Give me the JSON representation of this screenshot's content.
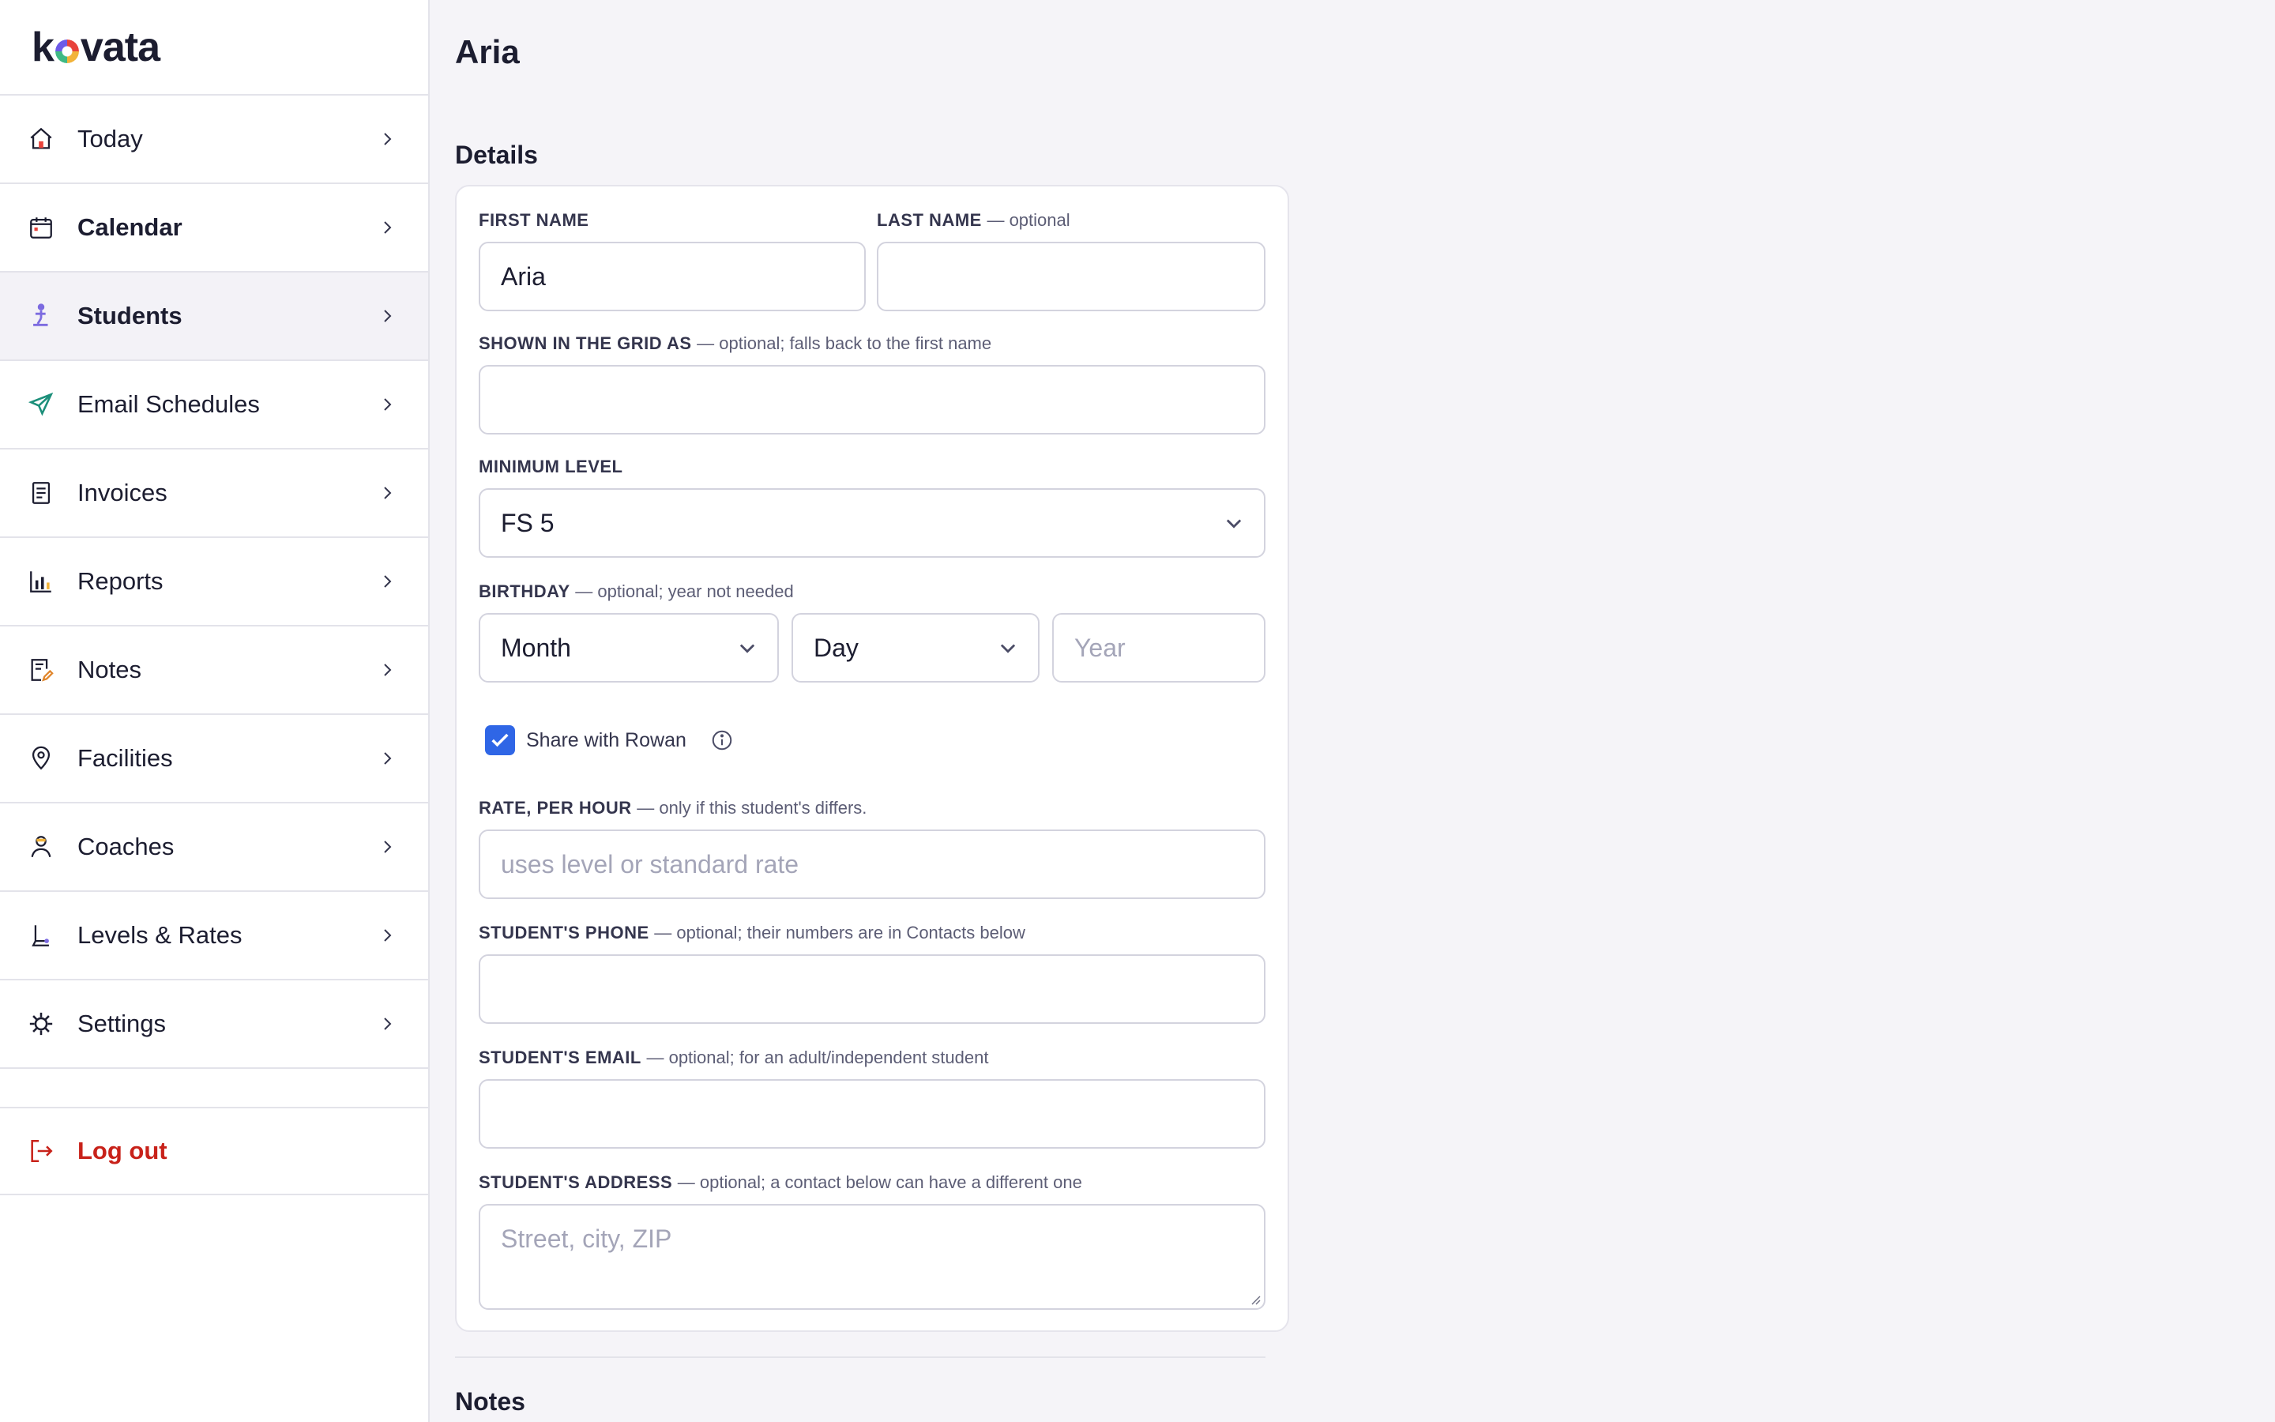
{
  "brand": {
    "name_k": "k",
    "name_rest": "vata"
  },
  "sidebar": {
    "items": [
      {
        "label": "Today",
        "icon": "home-icon",
        "bold": false
      },
      {
        "label": "Calendar",
        "icon": "calendar-icon",
        "bold": true
      },
      {
        "label": "Students",
        "icon": "students-icon",
        "bold": true,
        "active": true
      },
      {
        "label": "Email Schedules",
        "icon": "paper-plane-icon"
      },
      {
        "label": "Invoices",
        "icon": "invoice-icon"
      },
      {
        "label": "Reports",
        "icon": "bar-chart-icon"
      },
      {
        "label": "Notes",
        "icon": "notes-icon"
      },
      {
        "label": "Facilities",
        "icon": "location-pin-icon"
      },
      {
        "label": "Coaches",
        "icon": "coach-icon"
      },
      {
        "label": "Levels & Rates",
        "icon": "levels-icon"
      },
      {
        "label": "Settings",
        "icon": "gear-icon"
      }
    ],
    "logout_label": "Log out"
  },
  "page": {
    "title": "Aria"
  },
  "details": {
    "section_title": "Details",
    "first_name": {
      "label": "FIRST NAME",
      "value": "Aria"
    },
    "last_name": {
      "label": "LAST NAME",
      "hint": "— optional",
      "value": ""
    },
    "grid_name": {
      "label": "SHOWN IN THE GRID AS",
      "hint": "— optional; falls back to the first name",
      "value": ""
    },
    "min_level": {
      "label": "MINIMUM LEVEL",
      "value": "FS 5"
    },
    "birthday": {
      "label": "BIRTHDAY",
      "hint": "— optional; year not needed",
      "month": "Month",
      "day": "Day",
      "year_placeholder": "Year"
    },
    "share": {
      "label": "Share with Rowan",
      "checked": true
    },
    "rate": {
      "label": "RATE, PER HOUR",
      "hint": "— only if this student's differs.",
      "placeholder": "uses level or standard rate"
    },
    "phone": {
      "label": "STUDENT'S PHONE",
      "hint": "— optional; their numbers are in Contacts below",
      "value": ""
    },
    "email": {
      "label": "STUDENT'S EMAIL",
      "hint": "— optional; for an adult/independent student",
      "value": ""
    },
    "address": {
      "label": "STUDENT'S ADDRESS",
      "hint": "— optional; a contact below can have a different one",
      "placeholder": "Street, city, ZIP"
    }
  },
  "notes": {
    "section_title": "Notes"
  },
  "colors": {
    "accent": "#2f66e6",
    "logout": "#c8221a",
    "students_icon": "#7c6be0"
  }
}
